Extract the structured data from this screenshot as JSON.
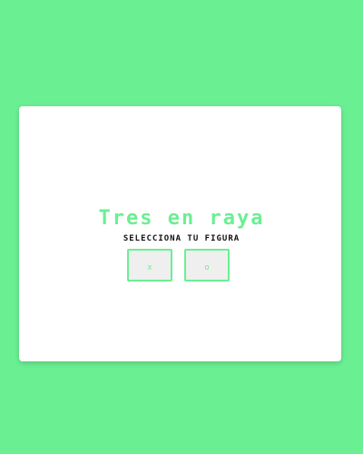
{
  "game": {
    "title": "Tres en raya",
    "subtitle": "Selecciona tu figura",
    "choices": {
      "x_label": "x",
      "o_label": "o"
    }
  },
  "colors": {
    "background": "#6bef93",
    "card": "#ffffff",
    "accent": "#6bef93",
    "button_fill": "#efefef",
    "text_dark": "#111111"
  }
}
